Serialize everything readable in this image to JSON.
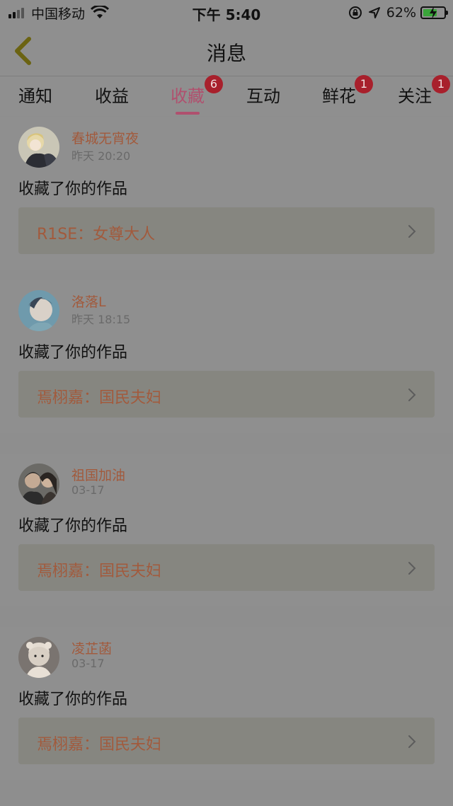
{
  "status_bar": {
    "carrier": "中国移动",
    "time": "下午 5:40",
    "battery": "62%"
  },
  "nav": {
    "title": "消息",
    "back_icon": "chevron-left-icon"
  },
  "tabs": [
    {
      "label": "通知",
      "badge": ""
    },
    {
      "label": "收益",
      "badge": ""
    },
    {
      "label": "收藏",
      "badge": "6"
    },
    {
      "label": "互动",
      "badge": ""
    },
    {
      "label": "鲜花",
      "badge": "1"
    },
    {
      "label": "关注",
      "badge": "1"
    }
  ],
  "messages": [
    {
      "name": "春城无宵夜",
      "time": "昨天 20:20",
      "action": "收藏了你的作品",
      "work": "R1SE：女尊大人"
    },
    {
      "name": "洛落L",
      "time": "昨天 18:15",
      "action": "收藏了你的作品",
      "work": "焉栩嘉：国民夫妇"
    },
    {
      "name": "祖国加油",
      "time": "03-17",
      "action": "收藏了你的作品",
      "work": "焉栩嘉：国民夫妇"
    },
    {
      "name": "凌芷菡",
      "time": "03-17",
      "action": "收藏了你的作品",
      "work": "焉栩嘉：国民夫妇"
    }
  ],
  "colors": {
    "accent": "#b0506e",
    "badge": "#a8202c",
    "name": "#a25a3c"
  }
}
